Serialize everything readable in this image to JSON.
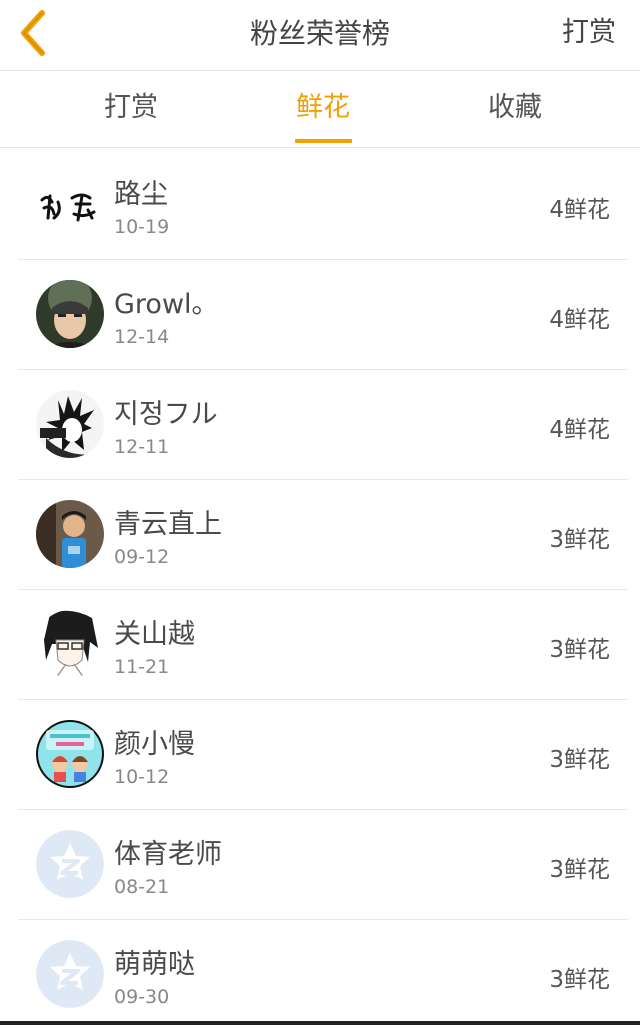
{
  "header": {
    "title": "粉丝荣誉榜",
    "action": "打赏",
    "back_icon": "chevron-left-icon",
    "accent": "#f0a000"
  },
  "tabs": [
    {
      "label": "打赏",
      "active": false
    },
    {
      "label": "鲜花",
      "active": true
    },
    {
      "label": "收藏",
      "active": false
    }
  ],
  "fans": [
    {
      "name": "路尘",
      "date": "10-19",
      "amount": "4鲜花",
      "avatar": "calligraphy-avatar"
    },
    {
      "name": "Growl。",
      "date": "12-14",
      "amount": "4鲜花",
      "avatar": "photo-avatar"
    },
    {
      "name": "지정フル",
      "date": "12-11",
      "amount": "4鲜花",
      "avatar": "anime-avatar"
    },
    {
      "name": "青云直上",
      "date": "09-12",
      "amount": "3鲜花",
      "avatar": "photo-avatar"
    },
    {
      "name": "关山越",
      "date": "11-21",
      "amount": "3鲜花",
      "avatar": "anime-avatar"
    },
    {
      "name": "颜小慢",
      "date": "10-12",
      "amount": "3鲜花",
      "avatar": "cartoon-avatar"
    },
    {
      "name": "体育老师",
      "date": "08-21",
      "amount": "3鲜花",
      "avatar": "default-qq-avatar"
    },
    {
      "name": "萌萌哒",
      "date": "09-30",
      "amount": "3鲜花",
      "avatar": "default-qq-avatar"
    }
  ]
}
